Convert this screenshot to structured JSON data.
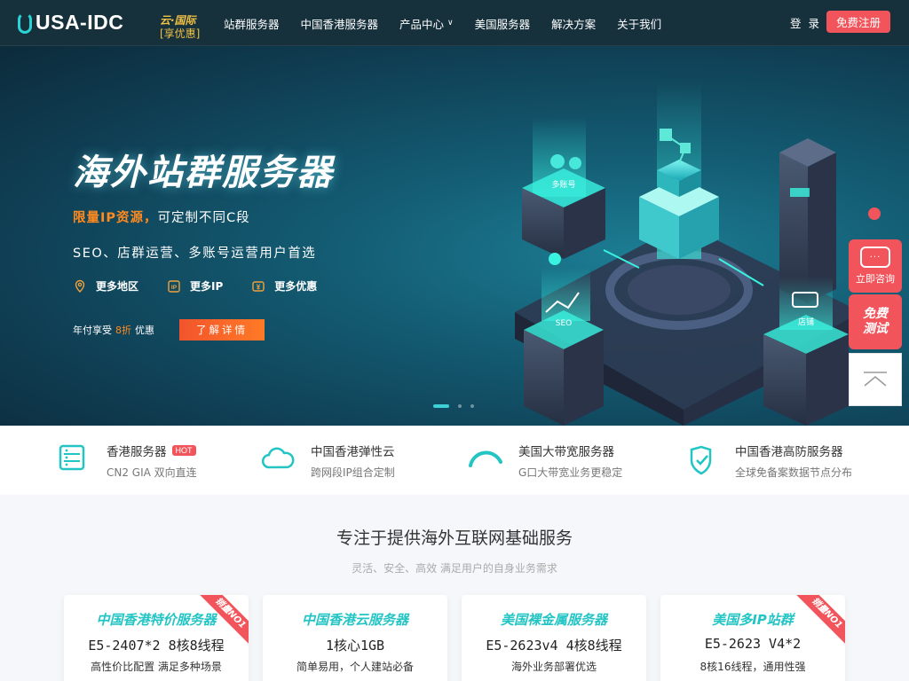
{
  "header": {
    "logo": "USA-IDC",
    "promo_line1": "云·国际",
    "promo_line2": "[享优惠]",
    "nav": [
      {
        "label": "站群服务器"
      },
      {
        "label": "中国香港服务器"
      },
      {
        "label": "产品中心",
        "has_dropdown": true
      },
      {
        "label": "美国服务器"
      },
      {
        "label": "解决方案"
      },
      {
        "label": "关于我们"
      }
    ],
    "login": "登 录",
    "register": "免费注册"
  },
  "hero": {
    "title": "海外站群服务器",
    "line1_highlight": "限量IP资源，",
    "line1_rest": "可定制不同C段",
    "line2": "SEO、店群运营、多账号运营用户首选",
    "features": [
      {
        "icon": "location-icon",
        "label": "更多地区"
      },
      {
        "icon": "ip-icon",
        "label": "更多IP"
      },
      {
        "icon": "yen-icon",
        "label": "更多优惠"
      }
    ],
    "discount_prefix": "年付享受",
    "discount_num": "8折",
    "discount_suffix": "优惠",
    "detail_button": "了解详情",
    "illus_labels": {
      "accounts": "多账号",
      "seo": "SEO",
      "shop": "店铺"
    }
  },
  "services": [
    {
      "icon": "server-icon",
      "title": "香港服务器",
      "badge": "HOT",
      "desc": "CN2 GIA 双向直连"
    },
    {
      "icon": "cloud-icon",
      "title": "中国香港弹性云",
      "badge": "",
      "desc": "跨网段IP组合定制"
    },
    {
      "icon": "bandwidth-icon",
      "title": "美国大带宽服务器",
      "badge": "",
      "desc": "G口大带宽业务更稳定"
    },
    {
      "icon": "shield-icon",
      "title": "中国香港高防服务器",
      "badge": "",
      "desc": "全球免备案数据节点分布"
    }
  ],
  "section": {
    "title": "专注于提供海外互联网基础服务",
    "subtitle": "灵活、安全、高效 满足用户的自身业务需求"
  },
  "cards": [
    {
      "title": "中国香港特价服务器",
      "spec": "E5-2407*2 8核8线程",
      "desc": "高性价比配置 满足多种场景",
      "ribbon": "销量NO1"
    },
    {
      "title": "中国香港云服务器",
      "spec": "1核心1GB",
      "desc": "简单易用，个人建站必备",
      "ribbon": ""
    },
    {
      "title": "美国裸金属服务器",
      "spec": "E5-2623v4 4核8线程",
      "desc": "海外业务部署优选",
      "ribbon": ""
    },
    {
      "title": "美国多IP站群",
      "spec": "E5-2623 V4*2",
      "desc": "8核16线程，通用性强",
      "ribbon": "销量NO1"
    }
  ],
  "side": {
    "consult": "立即咨询",
    "trial_line1": "免费",
    "trial_line2": "测试"
  },
  "colors": {
    "accent": "#23c4c4",
    "brand_red": "#f2545b",
    "orange": "#ff8a1f",
    "header_bg": "#16303c"
  }
}
